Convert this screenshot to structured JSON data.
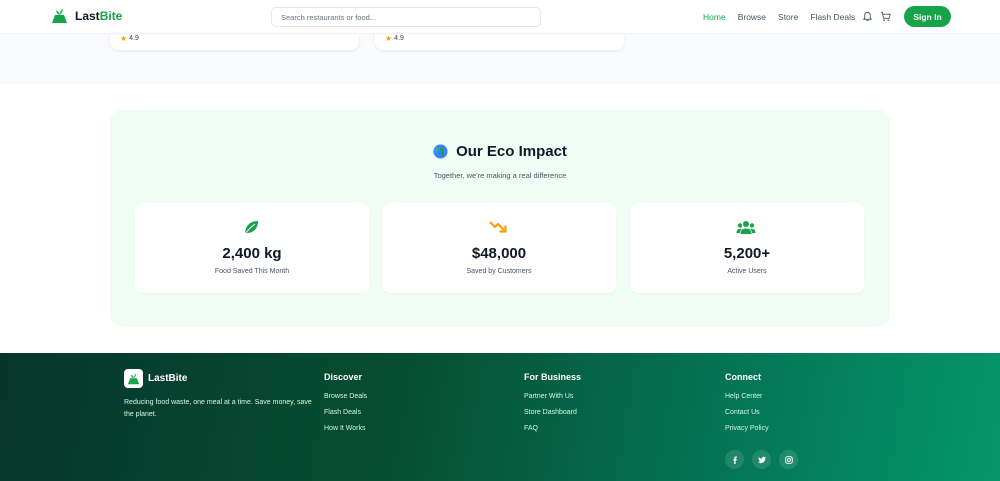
{
  "header": {
    "brand_part1": "Last",
    "brand_part2": "Bite",
    "search_placeholder": "Search restaurants or food...",
    "nav": [
      "Home",
      "Browse",
      "Store",
      "Flash Deals"
    ],
    "signin_label": "Sign In",
    "accent_color": "#16a34a"
  },
  "top_cards": [
    {
      "rating": "4.9"
    },
    {
      "rating": "4.9"
    }
  ],
  "eco": {
    "title": "Our Eco Impact",
    "subtitle": "Together, we're making a real difference",
    "stats": [
      {
        "value": "2,400 kg",
        "label": "Food Saved This Month",
        "icon": "leaf-icon",
        "color": "#16a34a"
      },
      {
        "value": "$48,000",
        "label": "Saved by Customers",
        "icon": "trend-down-icon",
        "color": "#f59e0b"
      },
      {
        "value": "5,200+",
        "label": "Active Users",
        "icon": "users-icon",
        "color": "#16a34a"
      }
    ]
  },
  "footer": {
    "brand": "LastBite",
    "tagline": "Reducing food waste, one meal at a time. Save money, save the planet.",
    "columns": [
      {
        "title": "Discover",
        "links": [
          "Browse Deals",
          "Flash Deals",
          "How It Works"
        ]
      },
      {
        "title": "For Business",
        "links": [
          "Partner With Us",
          "Store Dashboard",
          "FAQ"
        ]
      },
      {
        "title": "Connect",
        "links": [
          "Help Center",
          "Contact Us",
          "Privacy Policy"
        ]
      }
    ],
    "social": [
      "facebook-icon",
      "twitter-icon",
      "instagram-icon"
    ]
  }
}
